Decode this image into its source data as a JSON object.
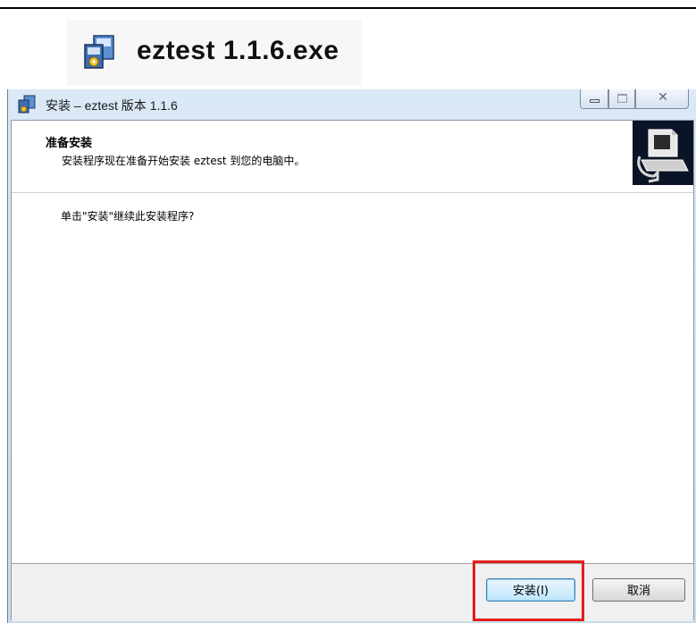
{
  "file": {
    "name": "eztest 1.1.6.exe",
    "icon": "installer-icon"
  },
  "window": {
    "title": "安装 – eztest 版本 1.1.6",
    "title_icon": "installer-icon",
    "controls": [
      "minimize",
      "maximize",
      "close"
    ],
    "close_glyph": "✕"
  },
  "page": {
    "heading": "准备安装",
    "subheading": "安装程序现在准备开始安装 eztest 到您的电脑中。",
    "body": "单击\"安装\"继续此安装程序?"
  },
  "buttons": {
    "install": "安装(I)",
    "cancel": "取消"
  },
  "colors": {
    "highlight": "#e41d1d",
    "wizard_image_bg": "#0b1426"
  }
}
